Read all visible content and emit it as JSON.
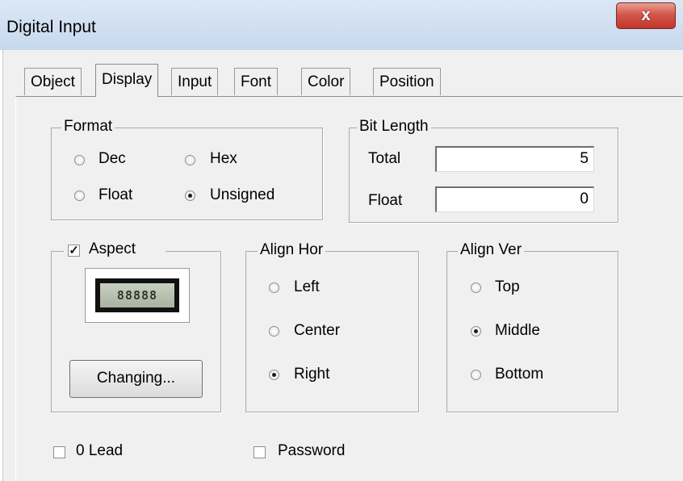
{
  "window": {
    "title": "Digital Input",
    "close_glyph": "x"
  },
  "tabs": [
    {
      "label": "Object",
      "active": false
    },
    {
      "label": "Display",
      "active": true
    },
    {
      "label": "Input",
      "active": false
    },
    {
      "label": "Font",
      "active": false
    },
    {
      "label": "Color",
      "active": false
    },
    {
      "label": "Position",
      "active": false
    }
  ],
  "format": {
    "label": "Format",
    "options": [
      "Dec",
      "Hex",
      "Float",
      "Unsigned"
    ],
    "selected": "Unsigned"
  },
  "bit_length": {
    "label": "Bit Length",
    "total_label": "Total",
    "total_value": "5",
    "float_label": "Float",
    "float_value": "0"
  },
  "aspect": {
    "label": "Aspect",
    "checked": true,
    "preview_text": "88888",
    "button_label": "Changing..."
  },
  "align_hor": {
    "label": "Align Hor",
    "options": [
      "Left",
      "Center",
      "Right"
    ],
    "selected": "Right"
  },
  "align_ver": {
    "label": "Align Ver",
    "options": [
      "Top",
      "Middle",
      "Bottom"
    ],
    "selected": "Middle"
  },
  "options": {
    "zero_lead": {
      "label": "0 Lead",
      "checked": false
    },
    "password": {
      "label": "Password",
      "checked": false
    }
  }
}
